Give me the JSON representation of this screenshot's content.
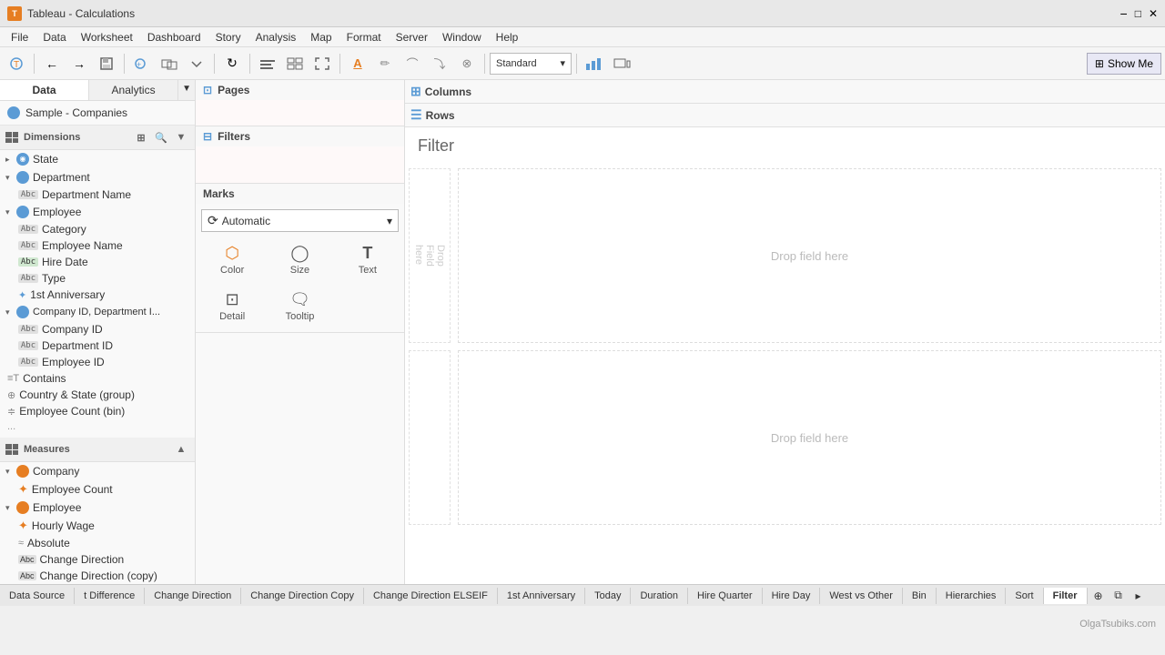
{
  "titleBar": {
    "title": "Tableau - Calculations",
    "appIcon": "T"
  },
  "menuBar": {
    "items": [
      "File",
      "Data",
      "Worksheet",
      "Dashboard",
      "Story",
      "Analysis",
      "Map",
      "Format",
      "Server",
      "Window",
      "Help"
    ]
  },
  "toolbar": {
    "standardLabel": "Standard",
    "showMeLabel": "Show Me"
  },
  "leftPanel": {
    "tabs": {
      "data": "Data",
      "analytics": "Analytics"
    },
    "dataSource": "Sample - Companies",
    "sections": {
      "dimensions": "Dimensions",
      "measures": "Measures"
    },
    "dimensionsGroups": [
      {
        "name": "State",
        "type": "geo",
        "expanded": false,
        "items": []
      },
      {
        "name": "Department",
        "type": "group",
        "expanded": true,
        "items": [
          {
            "name": "Department Name",
            "type": "abc"
          }
        ]
      },
      {
        "name": "Employee",
        "type": "group",
        "expanded": true,
        "items": [
          {
            "name": "Category",
            "type": "abc"
          },
          {
            "name": "Employee Name",
            "type": "abc"
          },
          {
            "name": "Hire Date",
            "type": "date"
          },
          {
            "name": "Type",
            "type": "abc"
          },
          {
            "name": "1st Anniversary",
            "type": "star"
          }
        ]
      },
      {
        "name": "Company ID, Department I...",
        "type": "group",
        "expanded": true,
        "items": [
          {
            "name": "Company ID",
            "type": "abc"
          },
          {
            "name": "Department ID",
            "type": "abc"
          },
          {
            "name": "Employee ID",
            "type": "abc"
          }
        ]
      },
      {
        "name": "Contains",
        "type": "calc",
        "items": []
      },
      {
        "name": "Country & State (group)",
        "type": "geo-group",
        "items": []
      },
      {
        "name": "Employee Count (bin)",
        "type": "bin",
        "items": []
      }
    ],
    "measuresGroups": [
      {
        "name": "Company",
        "type": "group",
        "expanded": true,
        "items": [
          {
            "name": "Employee Count",
            "type": "measure"
          }
        ]
      },
      {
        "name": "Employee",
        "type": "group",
        "expanded": true,
        "items": [
          {
            "name": "Hourly Wage",
            "type": "measure"
          },
          {
            "name": "Absolute",
            "type": "calc-measure"
          },
          {
            "name": "Change Direction",
            "type": "abc-measure"
          },
          {
            "name": "Change Direction (copy)",
            "type": "abc-measure"
          }
        ]
      }
    ]
  },
  "shelves": {
    "pages": "Pages",
    "filters": "Filters",
    "marks": "Marks",
    "columns": "Columns",
    "rows": "Rows"
  },
  "marks": {
    "typeLabel": "Automatic",
    "buttons": [
      {
        "label": "Color",
        "icon": "⬡"
      },
      {
        "label": "Size",
        "icon": "○"
      },
      {
        "label": "Text",
        "icon": "T"
      },
      {
        "label": "Detail",
        "icon": "⊡"
      },
      {
        "label": "Tooltip",
        "icon": "💬"
      }
    ]
  },
  "view": {
    "filterLabel": "Filter",
    "dropFieldHere": "Drop field here",
    "dropFieldHereLeft": "Drop\nField\nhere"
  },
  "bottomTabs": [
    {
      "label": "Data Source",
      "active": false
    },
    {
      "label": "t Difference",
      "active": false
    },
    {
      "label": "Change Direction",
      "active": false
    },
    {
      "label": "Change Direction Copy",
      "active": false
    },
    {
      "label": "Change Direction ELSEIF",
      "active": false
    },
    {
      "label": "1st Anniversary",
      "active": false
    },
    {
      "label": "Today",
      "active": false
    },
    {
      "label": "Duration",
      "active": false
    },
    {
      "label": "Hire Quarter",
      "active": false
    },
    {
      "label": "Hire Day",
      "active": false
    },
    {
      "label": "West vs Other",
      "active": false
    },
    {
      "label": "Bin",
      "active": false
    },
    {
      "label": "Hierarchies",
      "active": false
    },
    {
      "label": "Sort",
      "active": false
    },
    {
      "label": "Filter",
      "active": true
    }
  ],
  "watermark": "OlgaTsubiks.com"
}
